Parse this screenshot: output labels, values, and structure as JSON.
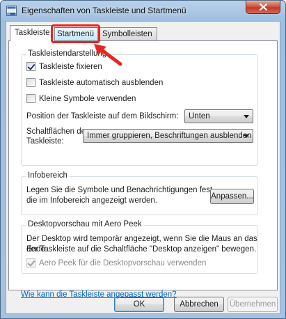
{
  "window": {
    "title": "Eigenschaften von Taskleiste und Startmenü",
    "close_icon": "close-icon",
    "app_icon": "taskbar-properties-icon"
  },
  "tabs": [
    {
      "label": "Taskleiste",
      "active": true
    },
    {
      "label": "Startmenü",
      "active": false
    },
    {
      "label": "Symbolleisten",
      "active": false
    }
  ],
  "taskbar_section": {
    "title": "Taskleistendarstellung",
    "checkboxes": [
      {
        "label": "Taskleiste fixieren",
        "checked": true
      },
      {
        "label": "Taskleiste automatisch ausblenden",
        "checked": false
      },
      {
        "label": "Kleine Symbole verwenden",
        "checked": false
      }
    ],
    "position_label": "Position der Taskleiste auf dem Bildschirm:",
    "position_value": "Unten",
    "buttons_label_line1": "Schaltflächen der",
    "buttons_label_line2": "Taskleiste:",
    "buttons_value": "Immer gruppieren, Beschriftungen ausblenden"
  },
  "notification_section": {
    "title": "Infobereich",
    "description_line1": "Legen Sie die Symbole und Benachrichtigungen fest,",
    "description_line2": "die im Infobereich angezeigt werden.",
    "customize_button": "Anpassen..."
  },
  "aero_section": {
    "title": "Desktopvorschau mit Aero Peek",
    "description_line1": "Der Desktop wird temporär angezeigt, wenn Sie die Maus an das Ende",
    "description_line2": "der Taskleiste auf die Schaltfläche \"Desktop anzeigen\" bewegen.",
    "checkbox_label": "Aero Peek für die Desktopvorschau verwenden",
    "checkbox_checked": true,
    "checkbox_disabled": true
  },
  "help_link": "Wie kann die Taskleiste angepasst werden?",
  "footer": {
    "ok": "OK",
    "cancel": "Abbrechen",
    "apply": "Übernehmen"
  },
  "annotation": {
    "highlight_color": "#e8261f"
  }
}
